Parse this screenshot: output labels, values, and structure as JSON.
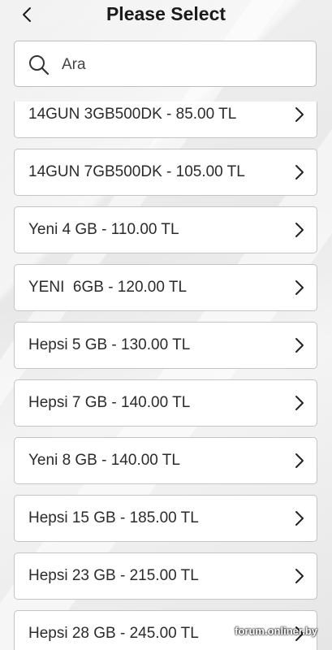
{
  "header": {
    "title": "Please Select",
    "back_icon": "chevron-left-icon"
  },
  "search": {
    "placeholder": "Ara",
    "value": "",
    "icon": "search-icon"
  },
  "items": [
    {
      "label": "14GUN 3GB500DK - 85.00 TL"
    },
    {
      "label": "14GUN 7GB500DK - 105.00 TL"
    },
    {
      "label": "Yeni 4 GB - 110.00 TL"
    },
    {
      "label": "YENI  6GB - 120.00 TL"
    },
    {
      "label": "Hepsi 5 GB - 130.00 TL"
    },
    {
      "label": "Hepsi 7 GB - 140.00 TL"
    },
    {
      "label": "Yeni 8 GB - 140.00 TL"
    },
    {
      "label": "Hepsi 15 GB - 185.00 TL"
    },
    {
      "label": "Hepsi 23 GB - 215.00 TL"
    },
    {
      "label": "Hepsi 28 GB - 245.00 TL"
    }
  ],
  "watermark": "forum.onliner.by",
  "colors": {
    "card_border": "#c4c4c4",
    "text": "#2b2b2b",
    "title": "#1a1a1a"
  }
}
